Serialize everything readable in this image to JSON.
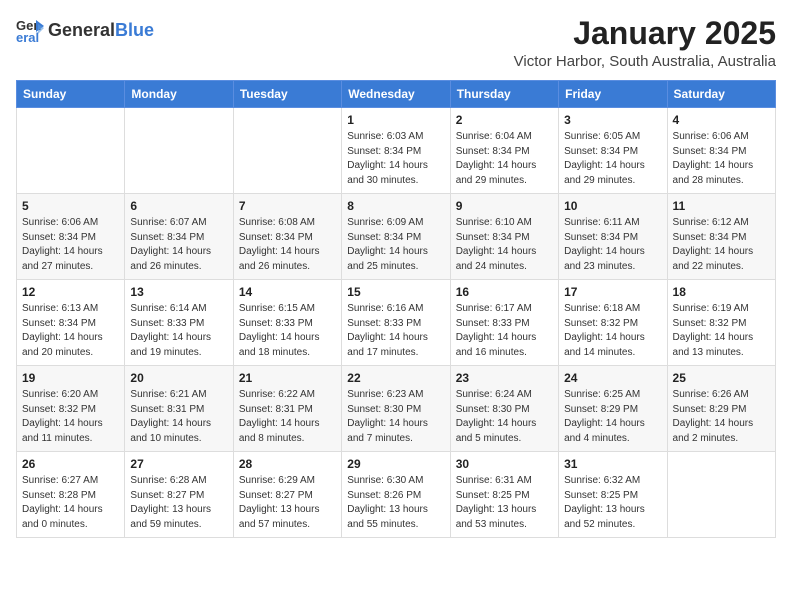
{
  "header": {
    "logo_general": "General",
    "logo_blue": "Blue",
    "title": "January 2025",
    "subtitle": "Victor Harbor, South Australia, Australia"
  },
  "weekdays": [
    "Sunday",
    "Monday",
    "Tuesday",
    "Wednesday",
    "Thursday",
    "Friday",
    "Saturday"
  ],
  "weeks": [
    [
      {
        "day": "",
        "info": ""
      },
      {
        "day": "",
        "info": ""
      },
      {
        "day": "",
        "info": ""
      },
      {
        "day": "1",
        "info": "Sunrise: 6:03 AM\nSunset: 8:34 PM\nDaylight: 14 hours\nand 30 minutes."
      },
      {
        "day": "2",
        "info": "Sunrise: 6:04 AM\nSunset: 8:34 PM\nDaylight: 14 hours\nand 29 minutes."
      },
      {
        "day": "3",
        "info": "Sunrise: 6:05 AM\nSunset: 8:34 PM\nDaylight: 14 hours\nand 29 minutes."
      },
      {
        "day": "4",
        "info": "Sunrise: 6:06 AM\nSunset: 8:34 PM\nDaylight: 14 hours\nand 28 minutes."
      }
    ],
    [
      {
        "day": "5",
        "info": "Sunrise: 6:06 AM\nSunset: 8:34 PM\nDaylight: 14 hours\nand 27 minutes."
      },
      {
        "day": "6",
        "info": "Sunrise: 6:07 AM\nSunset: 8:34 PM\nDaylight: 14 hours\nand 26 minutes."
      },
      {
        "day": "7",
        "info": "Sunrise: 6:08 AM\nSunset: 8:34 PM\nDaylight: 14 hours\nand 26 minutes."
      },
      {
        "day": "8",
        "info": "Sunrise: 6:09 AM\nSunset: 8:34 PM\nDaylight: 14 hours\nand 25 minutes."
      },
      {
        "day": "9",
        "info": "Sunrise: 6:10 AM\nSunset: 8:34 PM\nDaylight: 14 hours\nand 24 minutes."
      },
      {
        "day": "10",
        "info": "Sunrise: 6:11 AM\nSunset: 8:34 PM\nDaylight: 14 hours\nand 23 minutes."
      },
      {
        "day": "11",
        "info": "Sunrise: 6:12 AM\nSunset: 8:34 PM\nDaylight: 14 hours\nand 22 minutes."
      }
    ],
    [
      {
        "day": "12",
        "info": "Sunrise: 6:13 AM\nSunset: 8:34 PM\nDaylight: 14 hours\nand 20 minutes."
      },
      {
        "day": "13",
        "info": "Sunrise: 6:14 AM\nSunset: 8:33 PM\nDaylight: 14 hours\nand 19 minutes."
      },
      {
        "day": "14",
        "info": "Sunrise: 6:15 AM\nSunset: 8:33 PM\nDaylight: 14 hours\nand 18 minutes."
      },
      {
        "day": "15",
        "info": "Sunrise: 6:16 AM\nSunset: 8:33 PM\nDaylight: 14 hours\nand 17 minutes."
      },
      {
        "day": "16",
        "info": "Sunrise: 6:17 AM\nSunset: 8:33 PM\nDaylight: 14 hours\nand 16 minutes."
      },
      {
        "day": "17",
        "info": "Sunrise: 6:18 AM\nSunset: 8:32 PM\nDaylight: 14 hours\nand 14 minutes."
      },
      {
        "day": "18",
        "info": "Sunrise: 6:19 AM\nSunset: 8:32 PM\nDaylight: 14 hours\nand 13 minutes."
      }
    ],
    [
      {
        "day": "19",
        "info": "Sunrise: 6:20 AM\nSunset: 8:32 PM\nDaylight: 14 hours\nand 11 minutes."
      },
      {
        "day": "20",
        "info": "Sunrise: 6:21 AM\nSunset: 8:31 PM\nDaylight: 14 hours\nand 10 minutes."
      },
      {
        "day": "21",
        "info": "Sunrise: 6:22 AM\nSunset: 8:31 PM\nDaylight: 14 hours\nand 8 minutes."
      },
      {
        "day": "22",
        "info": "Sunrise: 6:23 AM\nSunset: 8:30 PM\nDaylight: 14 hours\nand 7 minutes."
      },
      {
        "day": "23",
        "info": "Sunrise: 6:24 AM\nSunset: 8:30 PM\nDaylight: 14 hours\nand 5 minutes."
      },
      {
        "day": "24",
        "info": "Sunrise: 6:25 AM\nSunset: 8:29 PM\nDaylight: 14 hours\nand 4 minutes."
      },
      {
        "day": "25",
        "info": "Sunrise: 6:26 AM\nSunset: 8:29 PM\nDaylight: 14 hours\nand 2 minutes."
      }
    ],
    [
      {
        "day": "26",
        "info": "Sunrise: 6:27 AM\nSunset: 8:28 PM\nDaylight: 14 hours\nand 0 minutes."
      },
      {
        "day": "27",
        "info": "Sunrise: 6:28 AM\nSunset: 8:27 PM\nDaylight: 13 hours\nand 59 minutes."
      },
      {
        "day": "28",
        "info": "Sunrise: 6:29 AM\nSunset: 8:27 PM\nDaylight: 13 hours\nand 57 minutes."
      },
      {
        "day": "29",
        "info": "Sunrise: 6:30 AM\nSunset: 8:26 PM\nDaylight: 13 hours\nand 55 minutes."
      },
      {
        "day": "30",
        "info": "Sunrise: 6:31 AM\nSunset: 8:25 PM\nDaylight: 13 hours\nand 53 minutes."
      },
      {
        "day": "31",
        "info": "Sunrise: 6:32 AM\nSunset: 8:25 PM\nDaylight: 13 hours\nand 52 minutes."
      },
      {
        "day": "",
        "info": ""
      }
    ]
  ]
}
